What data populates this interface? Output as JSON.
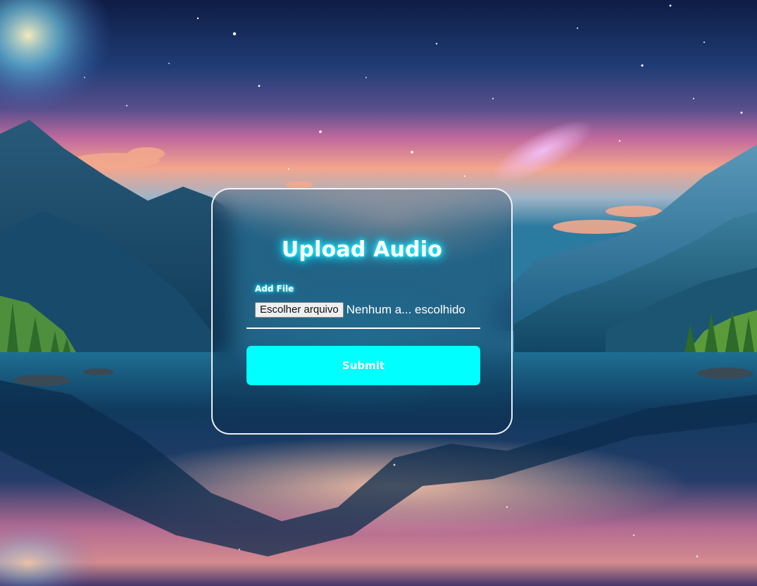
{
  "form": {
    "title": "Upload Audio",
    "file_label": "Add File",
    "file_button": "Escolher arquivo",
    "file_status": "Nenhum a... escolhido",
    "submit_label": "Submit"
  },
  "colors": {
    "accent": "#00ffff",
    "title_glow": "#16e8ff",
    "card_border": "#ffffff"
  }
}
